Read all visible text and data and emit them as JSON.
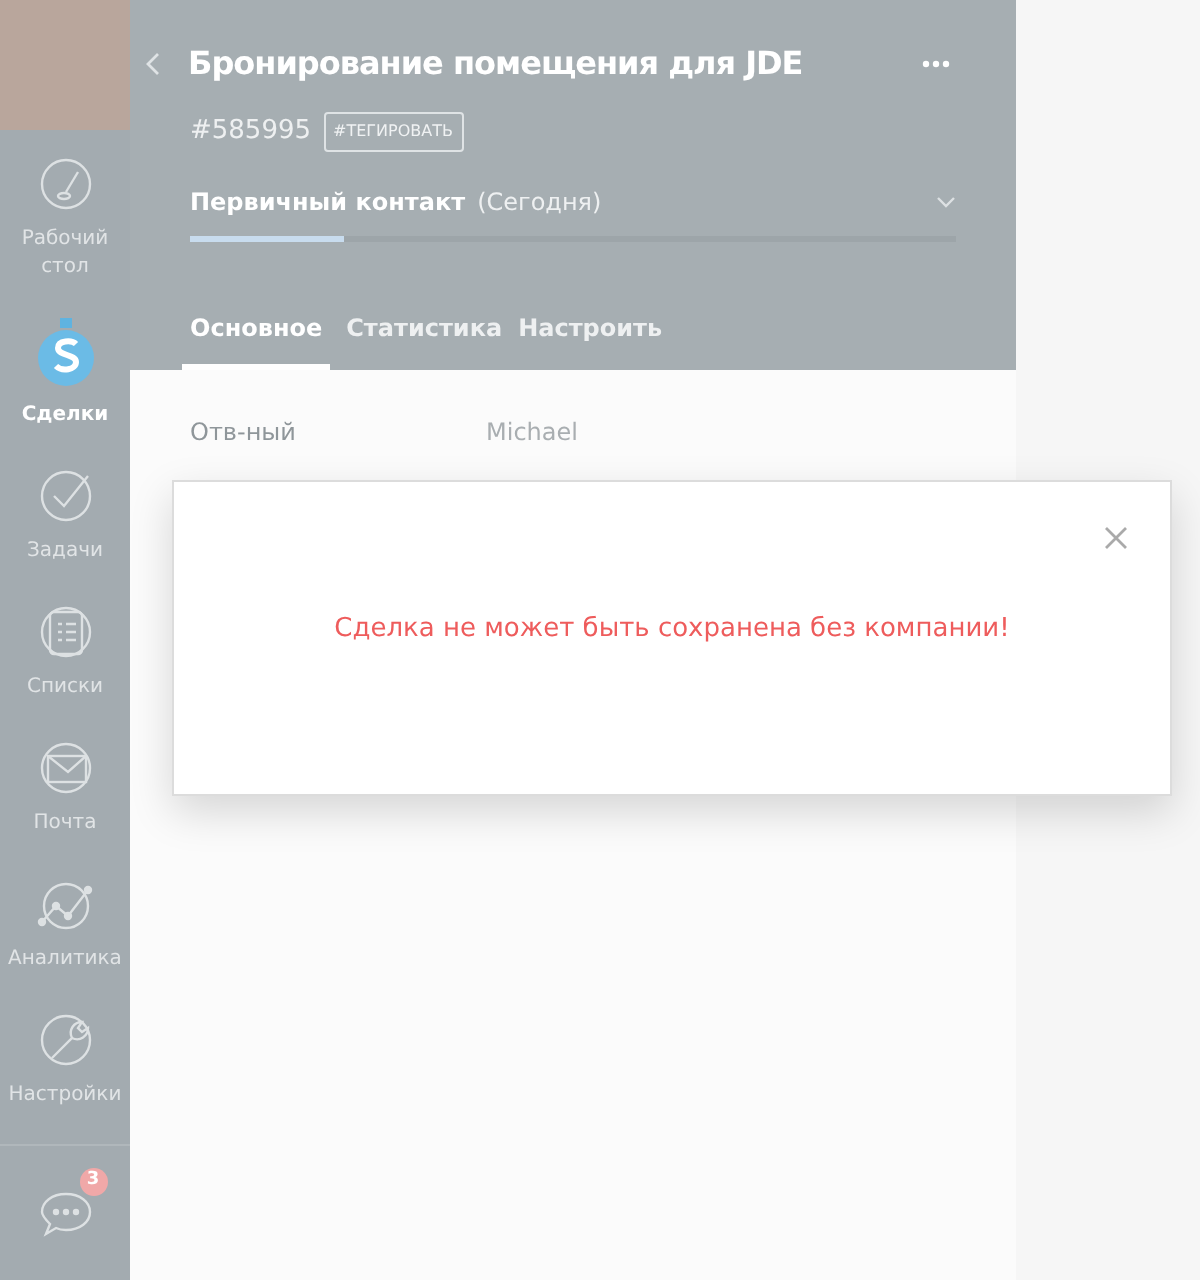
{
  "sidebar": {
    "items": [
      {
        "kind": "dashboard",
        "label": "Рабочий\nстол",
        "selected": false
      },
      {
        "kind": "deals",
        "label": "Сделки",
        "selected": true
      },
      {
        "kind": "tasks",
        "label": "Задачи",
        "selected": false
      },
      {
        "kind": "lists",
        "label": "Списки",
        "selected": false
      },
      {
        "kind": "mail",
        "label": "Почта",
        "selected": false
      },
      {
        "kind": "analytics",
        "label": "Аналитика",
        "selected": false
      },
      {
        "kind": "settings",
        "label": "Настройки",
        "selected": false
      }
    ],
    "chat_badge": "3"
  },
  "deal": {
    "title": "Бронирование помещения для JDE",
    "number": "#585995",
    "tag_button": "#ТЕГИРОВАТЬ",
    "stage": {
      "name": "Первичный контакт",
      "date": "(Сегодня)",
      "level": 0.2
    },
    "tabs": [
      {
        "label": "Основное",
        "selected": true
      },
      {
        "label": "Статистика",
        "selected": false
      },
      {
        "label": "Настроить",
        "selected": false
      }
    ],
    "fields": [
      {
        "label": "Отв-ный",
        "value": "Michael"
      }
    ]
  },
  "modal": {
    "message": "Сделка не может быть сохранена без компании!"
  }
}
